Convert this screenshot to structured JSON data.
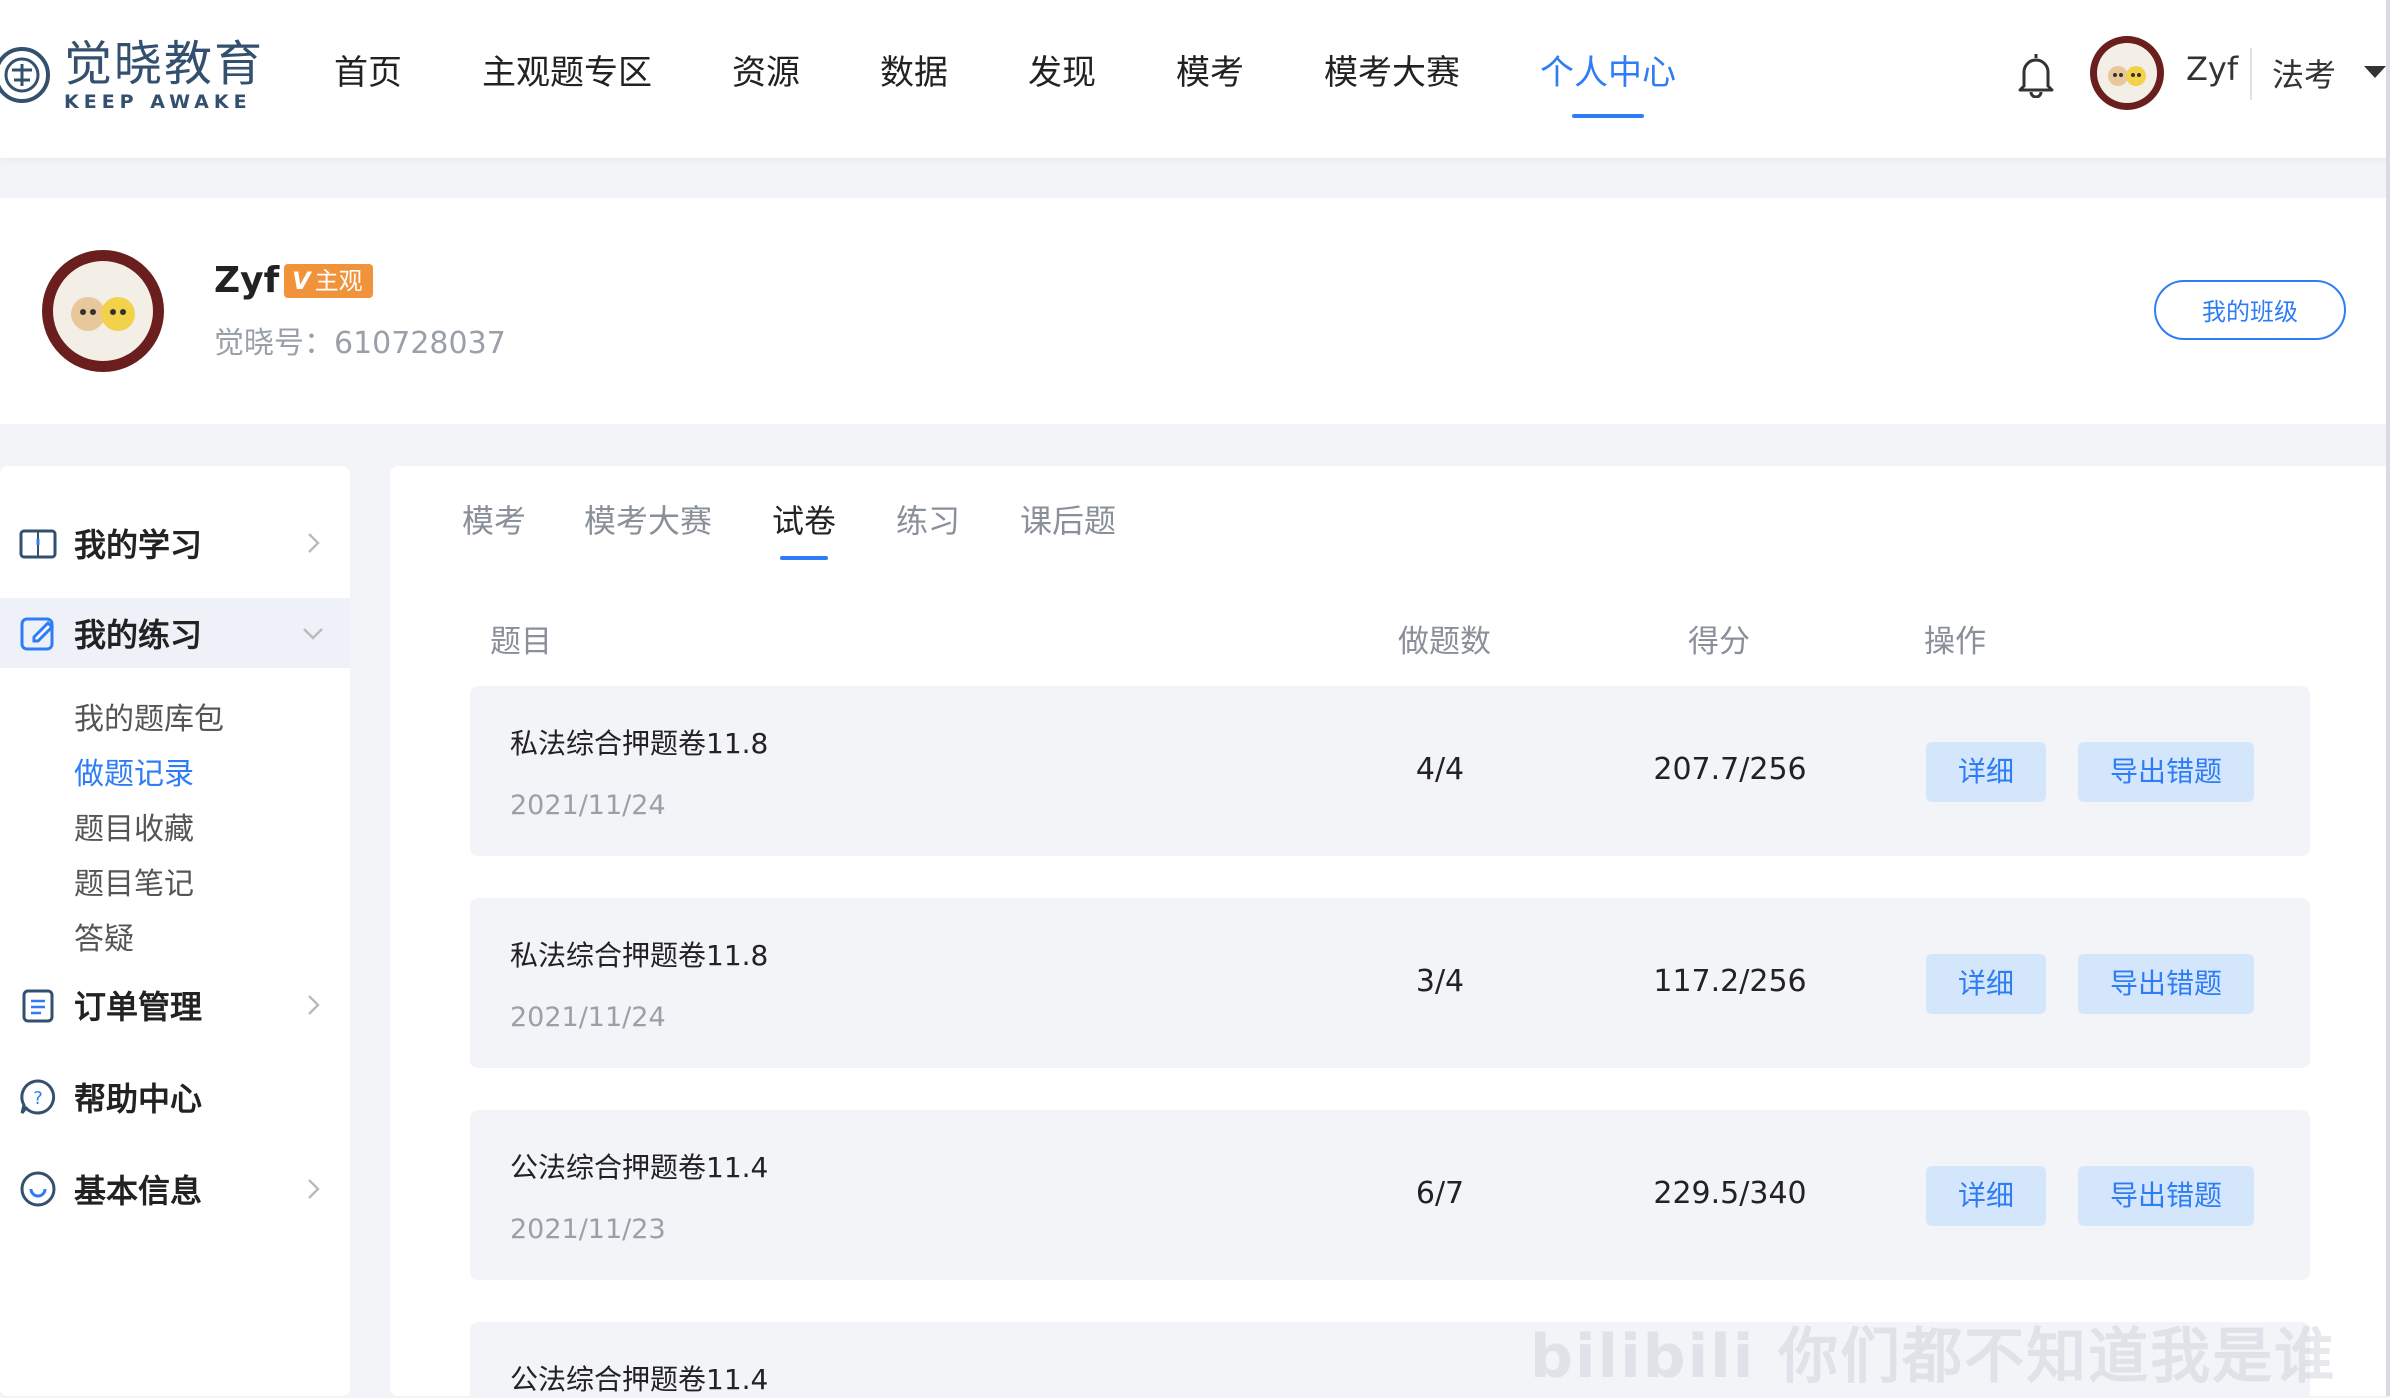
{
  "brand": {
    "name_cn": "觉晓教育",
    "name_en": "KEEP AWAKE"
  },
  "nav": {
    "items": [
      {
        "label": "首页"
      },
      {
        "label": "主观题专区"
      },
      {
        "label": "资源"
      },
      {
        "label": "数据"
      },
      {
        "label": "发现"
      },
      {
        "label": "模考"
      },
      {
        "label": "模考大赛"
      },
      {
        "label": "个人中心",
        "active": true
      }
    ],
    "user": "Zyf",
    "exam": "法考"
  },
  "profile": {
    "name": "Zyf",
    "badge_v": "V",
    "badge_text": "主观",
    "id_label": "觉晓号：",
    "id_value": "610728037",
    "class_button": "我的班级"
  },
  "sidebar": {
    "items": [
      {
        "label": "我的学习",
        "icon": "book-icon"
      },
      {
        "label": "我的练习",
        "icon": "edit-icon",
        "expanded": true,
        "children": [
          "我的题库包",
          "做题记录",
          "题目收藏",
          "题目笔记",
          "答疑"
        ],
        "active_child": "做题记录"
      },
      {
        "label": "订单管理",
        "icon": "clipboard-icon"
      },
      {
        "label": "帮助中心",
        "icon": "help-icon"
      },
      {
        "label": "基本信息",
        "icon": "info-icon"
      }
    ]
  },
  "tabs": [
    {
      "label": "模考"
    },
    {
      "label": "模考大赛"
    },
    {
      "label": "试卷",
      "active": true
    },
    {
      "label": "练习"
    },
    {
      "label": "课后题"
    }
  ],
  "table": {
    "headers": [
      "题目",
      "做题数",
      "得分",
      "操作"
    ],
    "detail_label": "详细",
    "export_label": "导出错题",
    "rows": [
      {
        "title": "私法综合押题卷11.8",
        "date": "2021/11/24",
        "count": "4/4",
        "score": "207.7/256"
      },
      {
        "title": "私法综合押题卷11.8",
        "date": "2021/11/24",
        "count": "3/4",
        "score": "117.2/256"
      },
      {
        "title": "公法综合押题卷11.4",
        "date": "2021/11/23",
        "count": "6/7",
        "score": "229.5/340"
      },
      {
        "title": "公法综合押题卷11.4",
        "date": "",
        "count": "",
        "score": ""
      }
    ]
  },
  "watermark": "bilibili 你们都不知道我是谁",
  "colors": {
    "accent": "#2f7df6",
    "badge": "#f0933a",
    "button_bg": "#d4e6fb",
    "row_bg": "#f2f4f7"
  }
}
